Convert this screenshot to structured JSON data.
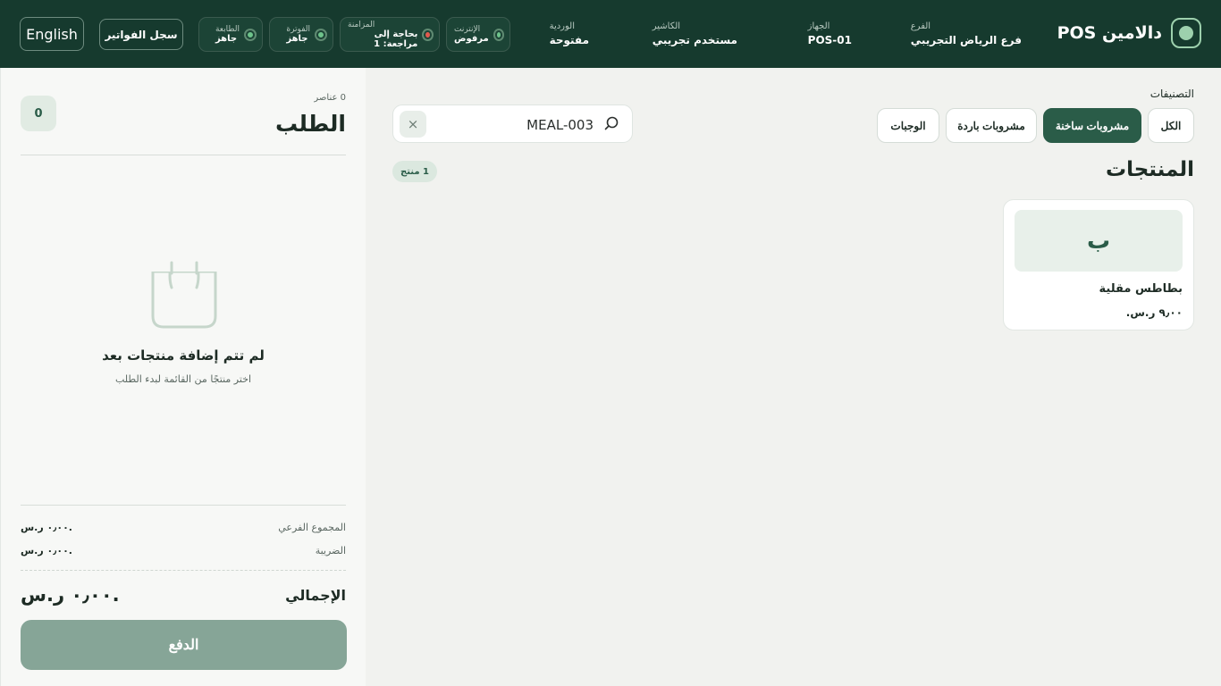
{
  "header": {
    "brand_name": "دالامين POS",
    "branch": {
      "label": "الفرع",
      "value": "فرع الرياض التجريبي"
    },
    "device": {
      "label": "الجهاز",
      "value": "POS-01"
    },
    "cashier": {
      "label": "الكاشير",
      "value": "مستخدم تجريبي"
    },
    "shift": {
      "label": "الوردية",
      "value": "مفتوحة"
    },
    "statuses": {
      "internet": {
        "label": "الإنترنت",
        "value": "مرفوض",
        "color": "#6ec38b"
      },
      "sync": {
        "label": "المزامنة",
        "value": "بحاجة إلى مراجعة: 1",
        "color": "#e05a4e"
      },
      "invoicing": {
        "label": "الفوترة",
        "value": "جاهز",
        "color": "#6ec38b"
      },
      "printer": {
        "label": "الطابعة",
        "value": "جاهز",
        "color": "#6ec38b"
      }
    },
    "invoices_button": "سجل الفواتير",
    "language_button": "English"
  },
  "catalog": {
    "categories_title": "التصنيفات",
    "categories": [
      {
        "label": "الكل",
        "active": false
      },
      {
        "label": "مشروبات ساخنة",
        "active": true
      },
      {
        "label": "مشروبات باردة",
        "active": false
      },
      {
        "label": "الوجبات",
        "active": false
      }
    ],
    "search": {
      "value": "MEAL-003",
      "clear_symbol": "×"
    },
    "products_title": "المنتجات",
    "count_label": "1 منتج",
    "products": [
      {
        "initial": "ب",
        "name": "بطاطس مقلية",
        "price": "٩٫٠٠ ر.س."
      }
    ]
  },
  "order": {
    "items_count": "0 عناصر",
    "title": "الطلب",
    "quantity": "0",
    "empty_title": "لم تتم إضافة منتجات بعد",
    "empty_subtitle": "اختر منتجًا من القائمة لبدء الطلب",
    "subtotal": {
      "label": "المجموع الفرعي",
      "value": "٠٫٠٠ ر.س."
    },
    "tax": {
      "label": "الضريبة",
      "value": "٠٫٠٠ ر.س."
    },
    "total": {
      "label": "الإجمالي",
      "value": "٠٫٠٠ ر.س."
    },
    "pay_button": "الدفع"
  },
  "colors": {
    "header_bg": "#163a2e",
    "accent": "#2a5c48",
    "pay_disabled": "#86a597"
  }
}
